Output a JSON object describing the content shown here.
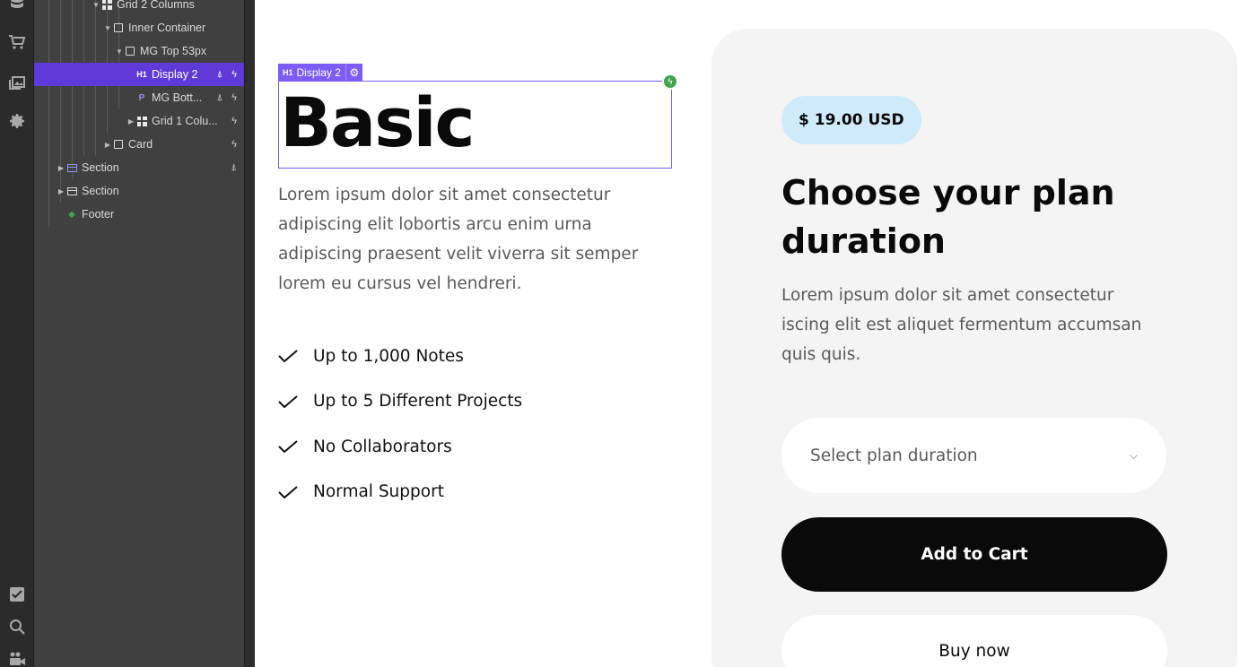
{
  "navigator": {
    "items": [
      {
        "label": "Grid 2 Columns",
        "icon": "grid-icon"
      },
      {
        "label": "Inner Container",
        "icon": "box-icon"
      },
      {
        "label": "MG Top 53px",
        "icon": "box-icon"
      },
      {
        "label": "Display 2",
        "icon": "h1-icon",
        "tag": "H1",
        "selected": true
      },
      {
        "label": "MG Bott...",
        "icon": "paragraph-icon",
        "tag": "P"
      },
      {
        "label": "Grid 1 Colu...",
        "icon": "grid-icon"
      },
      {
        "label": "Card",
        "icon": "box-icon"
      },
      {
        "label": "Section",
        "icon": "section-icon"
      },
      {
        "label": "Section",
        "icon": "section-icon"
      },
      {
        "label": "Footer",
        "icon": "component-icon"
      }
    ]
  },
  "rail": {
    "icons": [
      "database-icon",
      "cart-icon",
      "assets-icon",
      "settings-icon",
      "checklist-icon",
      "search-icon",
      "video-icon"
    ]
  },
  "selection": {
    "tag_prefix": "H1",
    "tag_label": "Display 2"
  },
  "content": {
    "heading": "Basic",
    "intro": "Lorem ipsum dolor sit amet consectetur adipiscing elit lobortis arcu enim urna adipiscing praesent velit viverra sit semper lorem eu cursus vel hendreri.",
    "features": [
      "Up to 1,000 Notes",
      "Up to 5 Different Projects",
      "No Collaborators",
      "Normal Support"
    ]
  },
  "card": {
    "price": "$ 19.00 USD",
    "title": "Choose your plan duration",
    "description": "Lorem ipsum dolor sit amet consectetur iscing elit est aliquet fermentum accumsan quis quis.",
    "select_placeholder": "Select plan duration",
    "add_to_cart": "Add to Cart",
    "buy_now": "Buy now"
  },
  "colors": {
    "selection": "#7c5cf5",
    "nav_selected": "#5e3bd9",
    "badge_bg": "#cfeafb",
    "card_bg": "#f4f4f4"
  }
}
